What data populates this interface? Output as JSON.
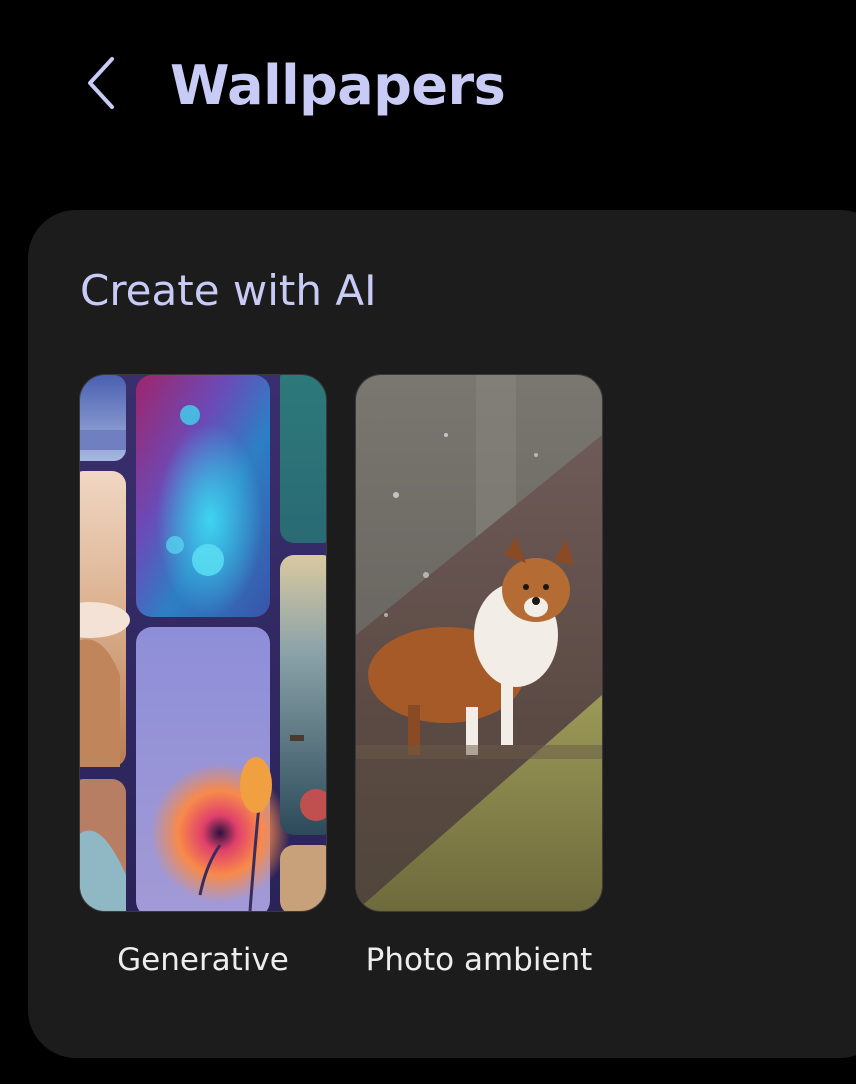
{
  "header": {
    "back_icon": "chevron-left-icon",
    "title": "Wallpapers"
  },
  "section": {
    "title": "Create with AI",
    "options": [
      {
        "label": "Generative",
        "thumbnail": "generative-collage-image"
      },
      {
        "label": "Photo ambient",
        "thumbnail": "sheltie-dog-photo-image"
      }
    ]
  },
  "colors": {
    "background": "#000000",
    "card": "#1c1c1c",
    "accent_text": "#c7cbf5",
    "label_text": "#ededed"
  }
}
